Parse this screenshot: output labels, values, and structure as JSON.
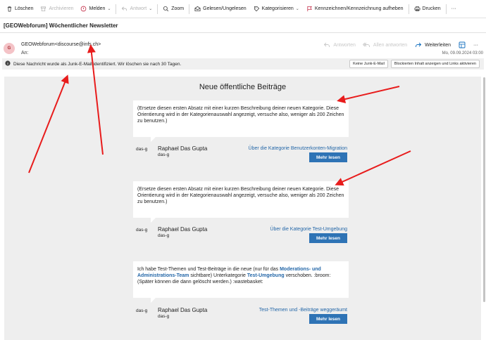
{
  "toolbar": {
    "delete": "Löschen",
    "archive": "Archivieren",
    "report": "Melden",
    "reply": "Antwort",
    "zoom": "Zoom",
    "read_unread": "Gelesen/Ungelesen",
    "categorize": "Kategorisieren",
    "flag": "Kennzeichnen/Kennzeichnung aufheben",
    "print": "Drucken",
    "more": "···"
  },
  "message": {
    "subject": "[GEOWebforum] Wöchentlicher Newsletter",
    "avatar_initial": "G",
    "sender": "GEOWebforum<discourse@infs.ch>",
    "to_label": "An:",
    "date": "Mo, 09.09.2024 03:00",
    "actions": {
      "reply": "Antworten",
      "reply_all": "Allen antworten",
      "forward": "Weiterleiten",
      "more": "···"
    }
  },
  "junk_banner": {
    "text": "Diese Nachricht wurde als Junk-E-Mail identifiziert. Wir löschen sie nach 30 Tagen.",
    "not_junk": "Keine Junk-E-Mail",
    "show_content": "Blockierten Inhalt anzeigen und Links aktivieren"
  },
  "newsletter": {
    "title": "Neue öffentliche Beiträge",
    "read_more": "Mehr lesen",
    "posts": [
      {
        "text": "(Ersetze diesen ersten Absatz mit einer kurzen Beschreibung deiner neuen Kategorie. Diese Orientierung wird in der Kategorienauswahl angezeigt, versuche also, weniger als 200 Zeichen zu benutzen.)",
        "username": "das-g",
        "full_name": "Raphael Das Gupta",
        "name_sub": "das-g",
        "link": "Über die Kategorie Benutzerkonten-Migration"
      },
      {
        "text": "(Ersetze diesen ersten Absatz mit einer kurzen Beschreibung deiner neuen Kategorie. Diese Orientierung wird in der Kategorienauswahl angezeigt, versuche also, weniger als 200 Zeichen zu benutzen.)",
        "username": "das-g",
        "full_name": "Raphael Das Gupta",
        "name_sub": "das-g",
        "link": "Über die Kategorie Test-Umgebung"
      },
      {
        "text_1": "Ich habe Test-Themen und Test-Beiträge in die neue (nur für das ",
        "team": "Moderations- und Administrations-Team",
        "text_2": " sichtbare) Unterkategorie ",
        "subcat": "Test-Umgebung",
        "text_3": " verschoben. :broom: (Später können die dann gelöscht werden.) :wastebasket:",
        "username": "das-g",
        "full_name": "Raphael Das Gupta",
        "name_sub": "das-g",
        "link": "Test-Themen und -Beiträge weggeräumt"
      }
    ]
  },
  "colors": {
    "annotation_arrow": "#e81c1c",
    "button_blue": "#2e73b5",
    "link_blue": "#2467a8",
    "forward_blue": "#0f6cbd"
  }
}
